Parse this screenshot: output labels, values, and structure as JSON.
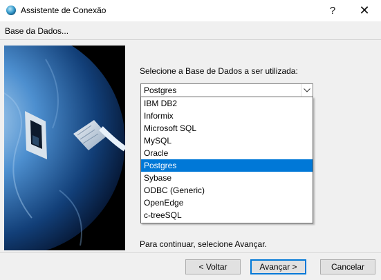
{
  "window": {
    "title": "Assistente de Conexão",
    "help_glyph": "?",
    "close_glyph": "✕"
  },
  "header": {
    "text": "Base da Dados..."
  },
  "form": {
    "prompt": "Selecione a Base de Dados a ser utilizada:",
    "selected_value": "Postgres",
    "options": [
      "IBM DB2",
      "Informix",
      "Microsoft SQL",
      "MySQL",
      "Oracle",
      "Postgres",
      "Sybase",
      "ODBC (Generic)",
      "OpenEdge",
      "c-treeSQL"
    ],
    "selected_index": 5,
    "hint": "Para continuar, selecione Avançar."
  },
  "buttons": {
    "back": "< Voltar",
    "next": "Avançar >",
    "cancel": "Cancelar"
  },
  "colors": {
    "selection": "#0078d7",
    "dialog_bg": "#f0f0f0"
  },
  "icons": [
    "app-globe-icon",
    "help-icon",
    "close-icon",
    "chevron-down-icon"
  ]
}
